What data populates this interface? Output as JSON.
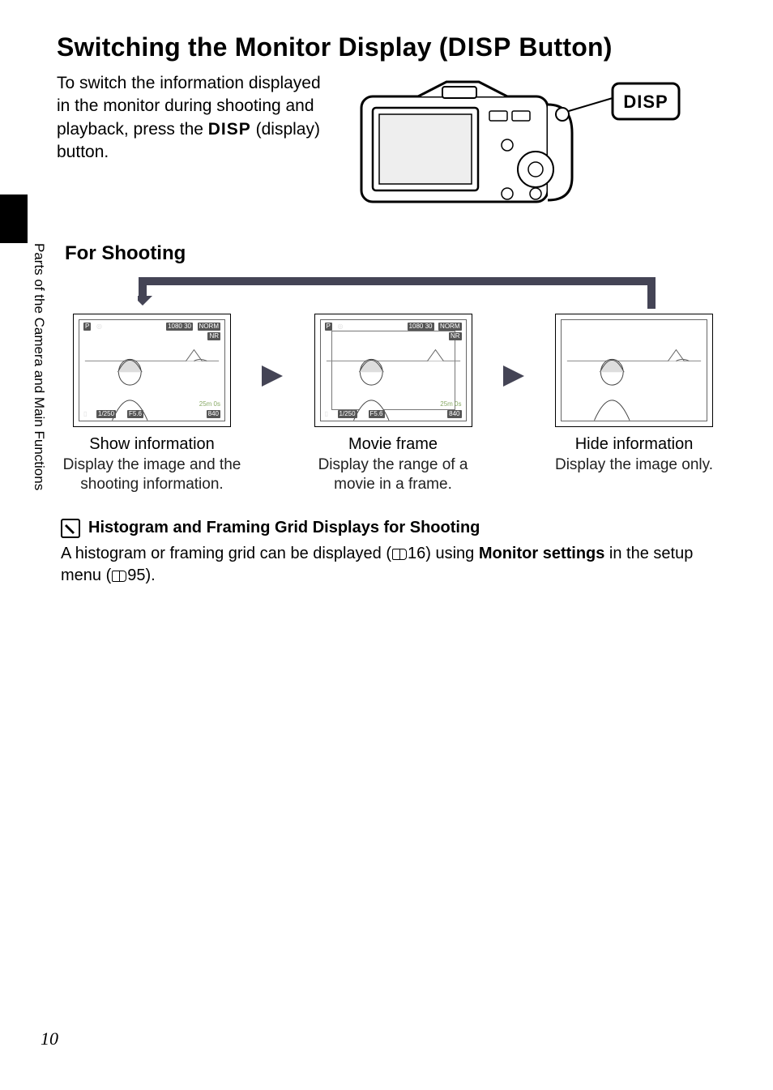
{
  "sideLabel": "Parts of the Camera and Main Functions",
  "title": {
    "pre": "Switching the Monitor Display (",
    "disp": "DISP",
    "post": " Button)"
  },
  "intro": {
    "l1": "To switch the information displayed",
    "l2": "in the monitor during shooting and",
    "l3a": "playback, press the ",
    "l3disp": "DISP",
    "l3b": " (display)",
    "l4": "button."
  },
  "calloutLabel": "DISP",
  "section": "For Shooting",
  "thumbs": [
    {
      "title": "Show information",
      "desc": "Display the image and the shooting information."
    },
    {
      "title": "Movie frame",
      "desc": "Display the range of a movie in a frame."
    },
    {
      "title": "Hide information",
      "desc": "Display the image only."
    }
  ],
  "osd": {
    "mode": "P",
    "quality": "NORM",
    "nr": "NR",
    "shutter": "1/250",
    "aperture": "F5.6",
    "time": "25m 0s",
    "count": "840",
    "video": "1080 30"
  },
  "note": {
    "title": "Histogram and Framing Grid Displays for Shooting",
    "body_a": "A histogram or framing grid can be displayed (",
    "ref1": "16",
    "body_b": ") using ",
    "strong": "Monitor settings",
    "body_c": " in the setup menu (",
    "ref2": "95",
    "body_d": ")."
  },
  "pageNumber": "10"
}
